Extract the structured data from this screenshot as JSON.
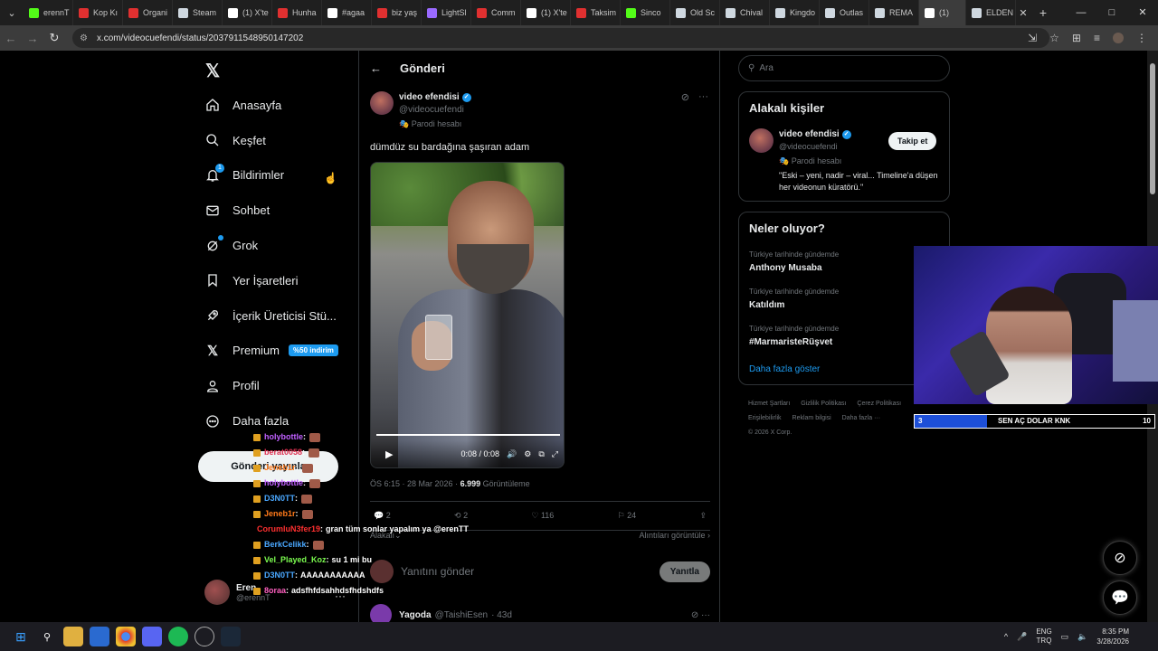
{
  "browser": {
    "tabs": [
      {
        "label": "erennT",
        "color": "#53fc18"
      },
      {
        "label": "Kop Kı",
        "color": "#e03030"
      },
      {
        "label": "Organi",
        "color": "#e03030"
      },
      {
        "label": "Steam",
        "color": "#cfd8e0"
      },
      {
        "label": "(1) X'te",
        "color": "#ffffff"
      },
      {
        "label": "Hunha",
        "color": "#e03030"
      },
      {
        "label": "#agaa",
        "color": "#ffffff"
      },
      {
        "label": "biz yaş",
        "color": "#e03030"
      },
      {
        "label": "LightSl",
        "color": "#9a6aff"
      },
      {
        "label": "Comm",
        "color": "#e03030"
      },
      {
        "label": "(1) X'te",
        "color": "#ffffff"
      },
      {
        "label": "Taksim",
        "color": "#e03030"
      },
      {
        "label": "Sinco",
        "color": "#53fc18"
      },
      {
        "label": "Old Sc",
        "color": "#cfd8e0"
      },
      {
        "label": "Chival",
        "color": "#cfd8e0"
      },
      {
        "label": "Kingdo",
        "color": "#cfd8e0"
      },
      {
        "label": "Outlas",
        "color": "#cfd8e0"
      },
      {
        "label": "REMA",
        "color": "#cfd8e0"
      },
      {
        "label": "(1)",
        "color": "#ffffff"
      },
      {
        "label": "ELDEN",
        "color": "#cfd8e0"
      }
    ],
    "url": "x.com/videocuefendi/status/2037911548950147202"
  },
  "nav": {
    "items": [
      {
        "label": "Anasayfa",
        "icon": "home-icon"
      },
      {
        "label": "Keşfet",
        "icon": "search-icon"
      },
      {
        "label": "Bildirimler",
        "icon": "bell-icon",
        "badge": "1"
      },
      {
        "label": "Sohbet",
        "icon": "mail-icon"
      },
      {
        "label": "Grok",
        "icon": "grok-icon"
      },
      {
        "label": "Yer İşaretleri",
        "icon": "bookmark-icon"
      },
      {
        "label": "İçerik Üreticisi Stü...",
        "icon": "rocket-icon"
      },
      {
        "label": "Premium",
        "icon": "x-logo-icon",
        "promo": "%50 indirim"
      },
      {
        "label": "Profil",
        "icon": "person-icon"
      },
      {
        "label": "Daha fazla",
        "icon": "more-circle-icon"
      }
    ],
    "post_button": "Gönderi yayınla",
    "profile": {
      "name": "Eren",
      "handle": "@erennT"
    }
  },
  "post": {
    "header": "Gönderi",
    "author_name": "video efendisi",
    "author_handle": "@videocuefendi",
    "parody_label": "Parodi hesabı",
    "text": "dümdüz su bardağına şaşıran adam",
    "video_time": "0:08 / 0:08",
    "date": "ÖS 6:15 · 28 Mar 2026 · ",
    "views": "6.999",
    "views_label": " Görüntüleme",
    "replies": "2",
    "reposts": "2",
    "likes": "116",
    "bookmarks": "24",
    "sort_label": "Alakalı",
    "quotes_label": "Alıntıları görüntüle",
    "reply_placeholder": "Yanıtını gönder",
    "reply_button": "Yanıtla",
    "next_reply": {
      "name": "Yagoda",
      "handle": "@TaishiEsen",
      "time": "· 43d"
    }
  },
  "sidebar": {
    "search_placeholder": "Ara",
    "related_title": "Alakalı kişiler",
    "related": {
      "name": "video efendisi",
      "handle": "@videocuefendi",
      "parody": "Parodi hesabı",
      "bio": "\"Eski – yeni, nadir – viral... Timeline'a düşen her videonun küratörü.\"",
      "follow": "Takip et"
    },
    "trends_title": "Neler oluyor?",
    "trends": [
      {
        "context": "Türkiye tarihinde gündemde",
        "title": "Anthony Musaba"
      },
      {
        "context": "Türkiye tarihinde gündemde",
        "title": "Katıldım"
      },
      {
        "context": "Türkiye tarihinde gündemde",
        "title": "#MarmaristeRüşvet"
      }
    ],
    "show_more": "Daha fazla göster",
    "footer": [
      "Hizmet Şartları",
      "Gizlilik Politikası",
      "Çerez Politikası",
      "Erişilebilirlik",
      "Reklam bilgisi",
      "Daha fazla ···",
      "© 2026 X Corp."
    ]
  },
  "overlay": {
    "donate_left": "3",
    "donate_text": "SEN AÇ DOLAR KNK",
    "donate_right": "10",
    "donate_progress": 0.3,
    "chat": [
      {
        "user": "holybottle",
        "color": "#c060ff",
        "msg": ""
      },
      {
        "user": "berat0058",
        "color": "#e03050",
        "msg": ""
      },
      {
        "user": "Jeneb1r",
        "color": "#ff7a1a",
        "msg": ""
      },
      {
        "user": "holybottle",
        "color": "#c060ff",
        "msg": ""
      },
      {
        "user": "D3N0TT",
        "color": "#4aa8ff",
        "msg": ""
      },
      {
        "user": "Jeneb1r",
        "color": "#ff7a1a",
        "msg": ""
      },
      {
        "user": "CorumluN3fer19",
        "color": "#ff3030",
        "msg": "gran tüm sonlar yapalım ya @erenTT"
      },
      {
        "user": "BerkCelikk",
        "color": "#4aa8ff",
        "msg": ""
      },
      {
        "user": "Vel_Played_Koz",
        "color": "#7cfc50",
        "msg": "su 1 mi bu"
      },
      {
        "user": "D3N0TT",
        "color": "#4aa8ff",
        "msg": "AAAAAAAAAAA"
      },
      {
        "user": "8oraa",
        "color": "#ff60c0",
        "msg": "adsfhfdsahhdsfhdshdfs"
      }
    ]
  },
  "taskbar": {
    "lang_top": "ENG",
    "lang_bottom": "TRQ",
    "time": "8:35 PM",
    "date": "3/28/2026"
  }
}
